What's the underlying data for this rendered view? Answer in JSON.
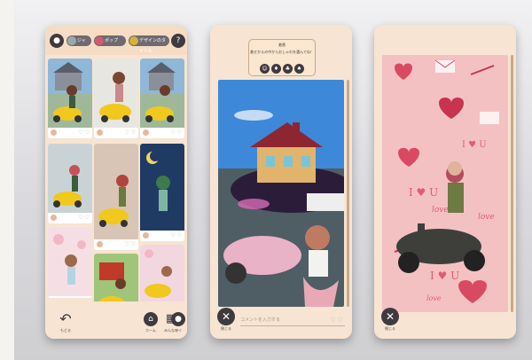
{
  "phone1": {
    "top_bar": {
      "left_icon": "mic-icon",
      "pills": [
        "ジャ",
        "ポップ",
        "デザインのタイトル"
      ],
      "right_icon": "help-icon"
    },
    "bottom_nav": {
      "back_label": "もどる",
      "items": [
        {
          "icon": "home-icon",
          "label": "ホーム"
        },
        {
          "icon": "grid-icon",
          "label": "みんなの"
        },
        {
          "icon": "mic-icon",
          "label": "マイ"
        }
      ]
    }
  },
  "phone2": {
    "popup_title": "着替",
    "popup_text": "着せかえの中からおしゃれを選んでね！",
    "close_label": "閉じる",
    "comment_placeholder": "コメントを入力する"
  },
  "phone3": {
    "close_label": "閉じる",
    "bg_texts": [
      "I ♥ U",
      "love",
      "love",
      "I ♥ U",
      "I ♥ U",
      "love"
    ]
  },
  "colors": {
    "phone_frame": "#f7e4d2",
    "pink_bg": "#f4c1c3",
    "icon_dark": "#3f3a40"
  }
}
